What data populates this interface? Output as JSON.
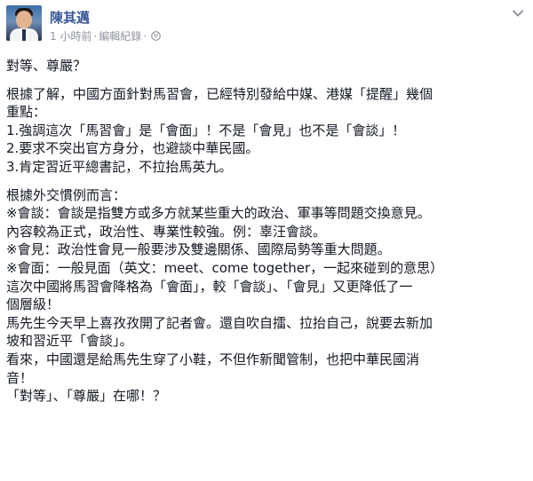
{
  "post": {
    "author": "陳其邁",
    "timestamp": "1 小時前",
    "separator": "·",
    "edited_label": "編輯紀錄",
    "separator2": "·",
    "privacy_icon": "globe-icon",
    "menu_icon": "chevron-down-icon",
    "colors": {
      "link": "#3b5998",
      "meta": "#90949c",
      "text": "#141823"
    },
    "lines": [
      "對等、尊嚴？",
      "根據了解，中國方面針對馬習會，已經特別發給中媒、港媒「提醒」幾個",
      "重點：",
      "1.強調這次「馬習會」是「會面」！不是「會見」也不是「會談」！",
      "2.要求不突出官方身分，也避談中華民國。",
      "3.肯定習近平總書記，不拉抬馬英九。",
      "根據外交慣例而言：",
      "※會談：會談是指雙方或多方就某些重大的政治、軍事等問題交換意見。",
      "內容較為正式，政治性、專業性較強。例：辜汪會談。",
      "※會見：政治性會見一般要涉及雙邊關係、國際局勢等重大問題。",
      "※會面：一般見面（英文：meet、come together，一起來碰到的意思）",
      "這次中國將馬習會降格為「會面」，較「會談」、「會見」又更降低了一",
      "個層級！",
      "馬先生今天早上喜孜孜開了記者會。還自吹自擂、拉抬自己，說要去新加",
      "坡和習近平「會談」。",
      "看來，中國還是給馬先生穿了小鞋，不但作新聞管制，也把中華民國消",
      "音！",
      "「對等」、「尊嚴」在哪！？"
    ]
  }
}
